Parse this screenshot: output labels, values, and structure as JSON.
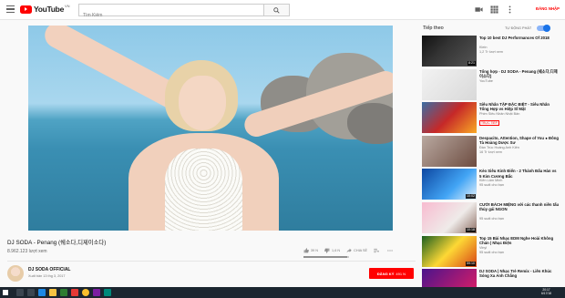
{
  "header": {
    "logo_text": "YouTube",
    "logo_region": "VN",
    "search_placeholder": "Tìm Kiếm",
    "signin_label": "ĐĂNG NHẬP"
  },
  "video": {
    "title": "DJ SODA - Penang (쉐소다,디제이소다)",
    "views": "8.962.123 lượt xem",
    "likes": "39 N",
    "dislikes": "1,6 N",
    "share_label": "CHIA SẺ",
    "channel": "DJ SODA OFFICIAL",
    "published": "Xuất bản 13 thg 3, 2017",
    "subscribe_label": "ĐĂNG KÝ",
    "subscriber_count": "491 N",
    "like_ratio": 0.96
  },
  "sidebar": {
    "up_next": "Tiếp theo",
    "autoplay_label": "TỰ ĐỘNG PHÁT",
    "items": [
      {
        "title": "Top 10 best DJ Performances Of 2018",
        "channel": "Klein",
        "views": "1,2 Tr lượt xem",
        "duration": "8:21",
        "live": ""
      },
      {
        "title": "Tổng hợp - DJ SODA - Penang (쉐소다,디제이소다)",
        "channel": "YouTube",
        "views": "",
        "duration": "",
        "live": ""
      },
      {
        "title": "Siêu Nhân TẬP ĐẶC BIỆT - Siêu Nhân Tổng Hợp vs Hiệp Sĩ Mặt",
        "channel": "Phim Siêu Nhân Nhật Bản",
        "views": "",
        "duration": "",
        "live": "TRỰC TIẾP"
      },
      {
        "title": "Despacito, Attention, Shape of You ● Đông Tà Hoàng Dược Sư",
        "channel": "Đàn Trúc Hoàng Anh Kiên",
        "views": "16 Tr lượt xem",
        "duration": "",
        "live": ""
      },
      {
        "title": "Kèo Siêu Kinh Điển - 2 Thánh Đấu Hàn vs 5 Kim Cương Bắc",
        "channel": "Kiên Lâm Minh",
        "views": "95 suất cho bạn",
        "duration": "10:02",
        "live": ""
      },
      {
        "title": "CƯỜI BÁCH MIỆNG với các thanh niên tấu thủy gái NGON",
        "channel": "",
        "views": "95 suất cho bạn",
        "duration": "10:18",
        "live": ""
      },
      {
        "title": "Top 15 Bài Nhạc EDM Nghe Hoài Không Chán | Nhạc Điện",
        "channel": "Vinyl",
        "views": "95 suất cho bạn",
        "duration": "59:10",
        "live": ""
      },
      {
        "title": "DJ SODA | Nhạc Trẻ Remix - Liên Khúc Sóng Xa Anh Chẳng",
        "channel": "",
        "views": "",
        "duration": "",
        "live": ""
      }
    ]
  },
  "taskbar": {
    "time": "20:17",
    "date": "6/17/18"
  },
  "colors": {
    "brand_red": "#ff0000",
    "toggle_blue": "#1a73e8"
  }
}
